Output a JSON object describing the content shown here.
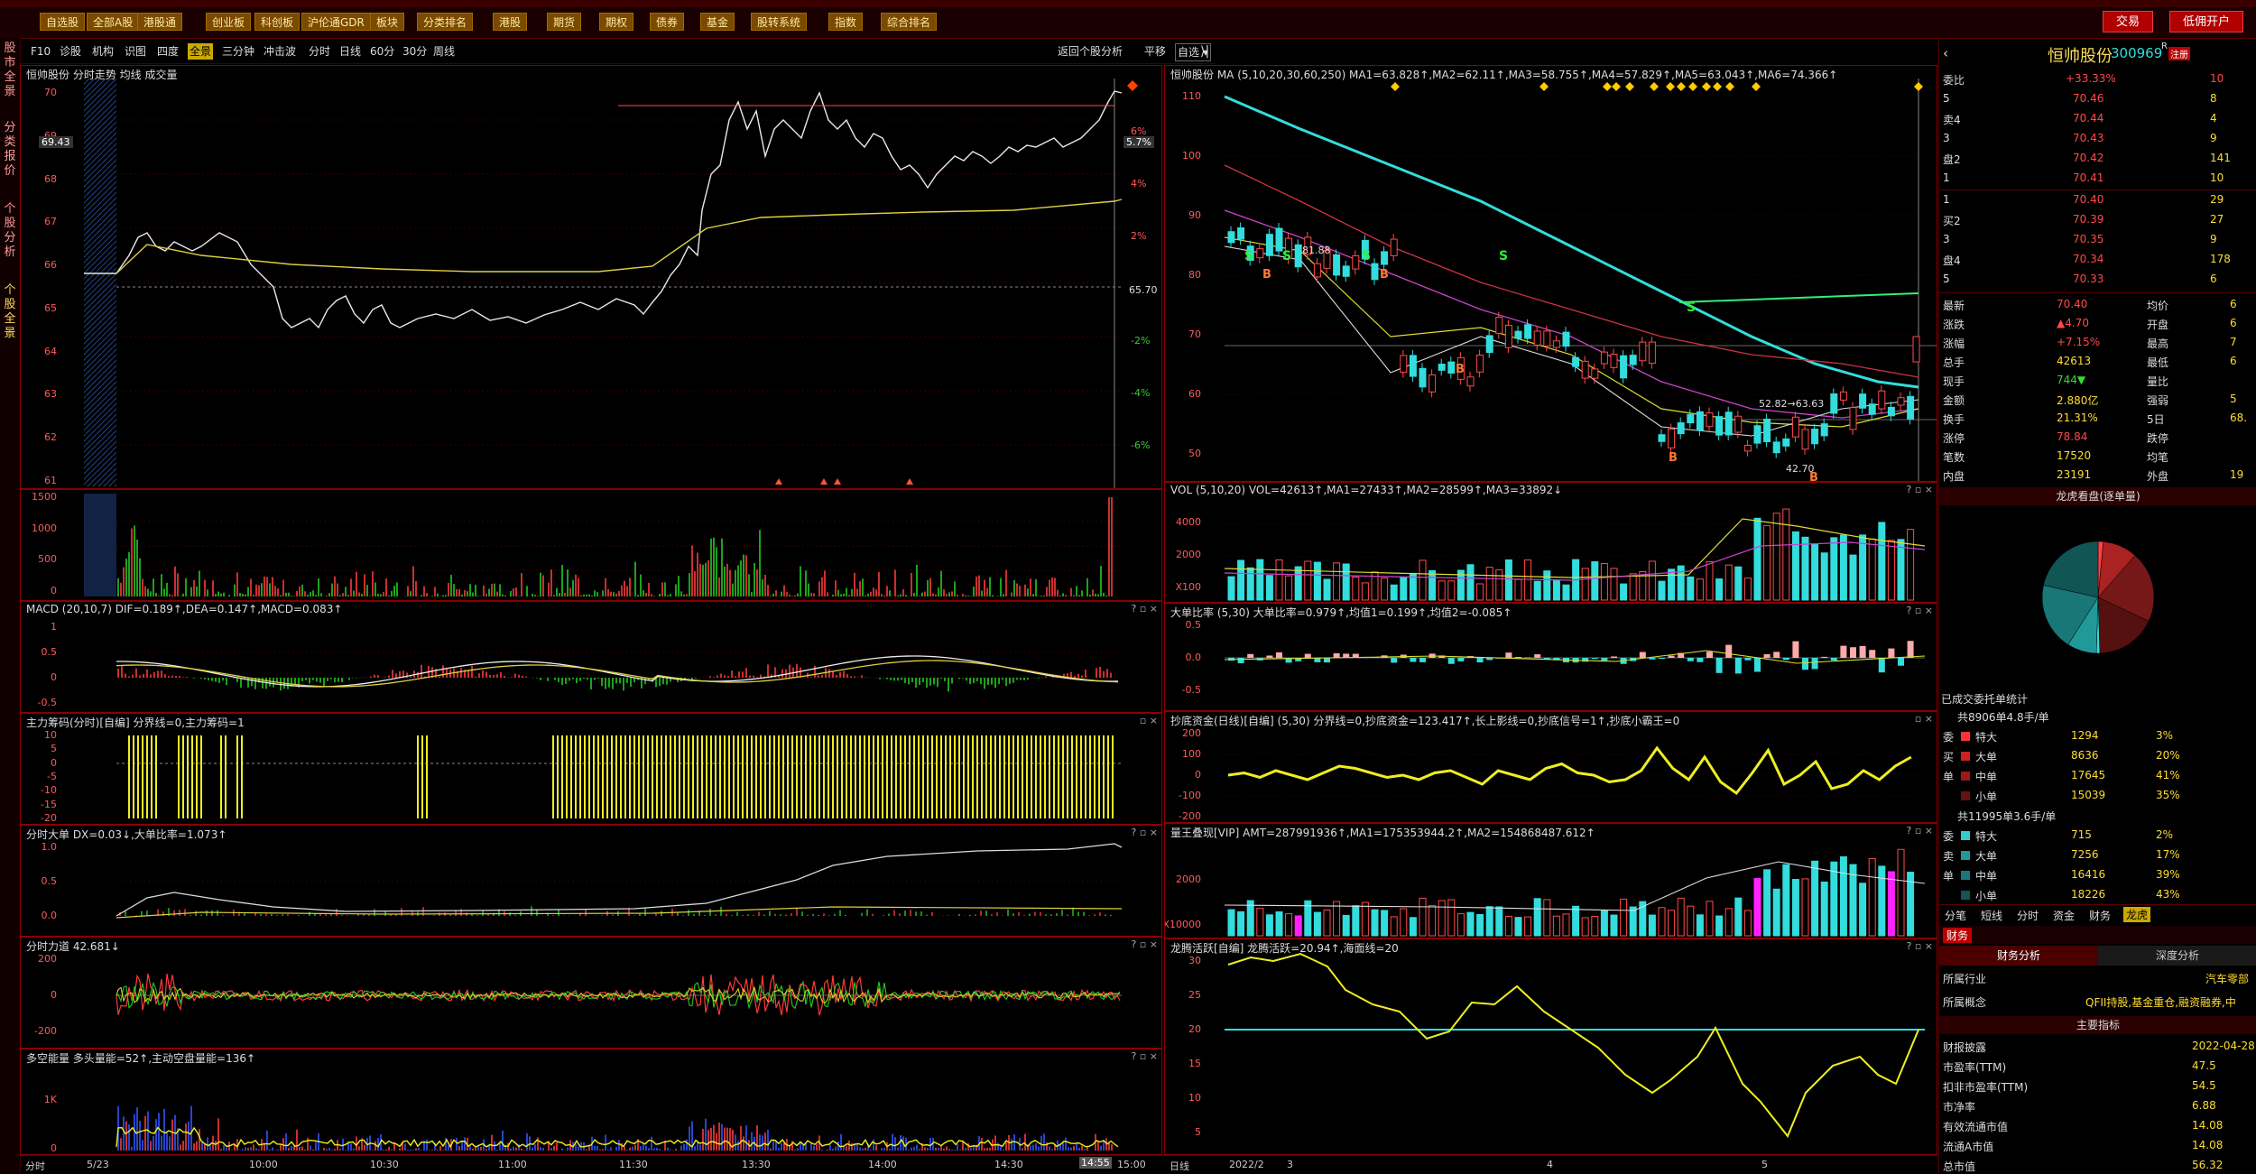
{
  "menubar": {
    "items": [
      "自选股",
      "全部A股",
      "港股通",
      "创业板",
      "科创板",
      "沪伦通GDR",
      "板块",
      "分类排名",
      "港股",
      "期货",
      "期权",
      "债券",
      "基金",
      "股转系统",
      "指数",
      "综合排名"
    ],
    "trade": "交易",
    "open_account": "低佣开户"
  },
  "leftstrip": {
    "tabs": [
      "股市全景",
      "分类报价",
      "个股分析",
      "个股全景"
    ]
  },
  "toolbar2": {
    "items": [
      "F10",
      "诊股",
      "机构",
      "识图",
      "四度",
      "全景",
      "三分钟",
      "冲击波",
      "分时",
      "日线",
      "60分",
      "30分",
      "周线"
    ],
    "selected": "全景",
    "return_label": "返回个股分析",
    "flat_label": "平移",
    "select_label": "自选"
  },
  "intraday": {
    "header": "恒帅股份  分时走势  均线  成交量",
    "price_label": "69.43",
    "pct_label": "5.7%",
    "mid_label": "65.70",
    "left_axis": [
      "70",
      "69",
      "68",
      "67",
      "66",
      "65",
      "64",
      "63",
      "62",
      "61"
    ],
    "right_axis": [
      "6%",
      "4%",
      "2%",
      "",
      "-2%",
      "-4%",
      "-6%"
    ],
    "vol_axis": [
      "1500",
      "1000",
      "500",
      "0"
    ],
    "macd_header": "MACD  (20,10,7)  DIF=0.189↑,DEA=0.147↑,MACD=0.083↑",
    "macd_axis": [
      "1",
      "0.5",
      "0",
      "-0.5"
    ],
    "chip_header": "主力筹码(分时)[自编]  分界线=0,主力筹码=1",
    "chip_axis": [
      "10",
      "5",
      "0",
      "-5",
      "-10",
      "-15",
      "-20"
    ],
    "bigorder_header": "分时大单  DX=0.03↓,大单比率=1.073↑",
    "bigorder_axis": [
      "1.0",
      "0.5",
      "0.0"
    ],
    "force_header": "分时力道  42.681↓",
    "force_axis": [
      "200",
      "0",
      "-200"
    ],
    "energy_header": "多空能量  多头量能=52↑,主动空盘量能=136↑",
    "energy_axis": [
      "1K",
      "0"
    ],
    "time_label": "分时",
    "times": [
      "5/23",
      "10:00",
      "10:30",
      "11:00",
      "11:30",
      "13:30",
      "14:00",
      "14:30",
      "14:55",
      "15:00"
    ]
  },
  "daily": {
    "header": "恒帅股份  MA  (5,10,20,30,60,250)  MA1=63.828↑,MA2=62.11↑,MA3=58.755↑,MA4=57.829↑,MA5=63.043↑,MA6=74.366↑",
    "left_axis": [
      "110",
      "100",
      "90",
      "80",
      "70",
      "60",
      "50"
    ],
    "annot_high": "81.88",
    "annot_low": "42.70",
    "annot_mid": "52.82→63.63",
    "vol_header": "VOL  (5,10,20)  VOL=42613↑,MA1=27433↑,MA2=28599↑,MA3=33892↓",
    "vol_axis": [
      "4000",
      "2000",
      "X100"
    ],
    "bigratio_header": "大单比率  (5,30)  大单比率=0.979↑,均值1=0.199↑,均值2=-0.085↑",
    "bigratio_axis": [
      "0.5",
      "0.0",
      "-0.5"
    ],
    "bottom_header": "抄底资金(日线)[自编]  (5,30)  分界线=0,抄底资金=123.417↑,长上影线=0,抄底信号=1↑,抄底小霸王=0",
    "bottom_axis": [
      "200",
      "100",
      "0",
      "-100",
      "-200"
    ],
    "kingvol_header": "量王叠现[VIP]  AMT=287991936↑,MA1=175353944.2↑,MA2=154868487.612↑",
    "kingvol_axis": [
      "2000",
      "X10000"
    ],
    "dragon_header": "龙腾活跃[自编]  龙腾活跃=20.94↑,海面线=20",
    "dragon_axis": [
      "30",
      "25",
      "20",
      "15",
      "10",
      "5"
    ],
    "day_label": "日线",
    "dates": [
      "2022/2",
      "3",
      "4",
      "5"
    ]
  },
  "quote": {
    "name": "恒帅股份",
    "code": "300969",
    "tag": "R",
    "tag2": "注册",
    "webi_label": "委比",
    "webi": "+33.33%",
    "webi_diff": "10",
    "sell": [
      {
        "lbl": "5",
        "price": "70.46",
        "vol": "8"
      },
      {
        "lbl": "卖4",
        "price": "70.44",
        "vol": "4"
      },
      {
        "lbl": "3",
        "price": "70.43",
        "vol": "9"
      },
      {
        "lbl": "盘2",
        "price": "70.42",
        "vol": "141"
      },
      {
        "lbl": "1",
        "price": "70.41",
        "vol": "10"
      }
    ],
    "buy": [
      {
        "lbl": "1",
        "price": "70.40",
        "vol": "29"
      },
      {
        "lbl": "买2",
        "price": "70.39",
        "vol": "27"
      },
      {
        "lbl": "3",
        "price": "70.35",
        "vol": "9"
      },
      {
        "lbl": "盘4",
        "price": "70.34",
        "vol": "178"
      },
      {
        "lbl": "5",
        "price": "70.33",
        "vol": "6"
      }
    ],
    "stats": [
      {
        "k": "最新",
        "v": "70.40",
        "k2": "均价",
        "v2": "6"
      },
      {
        "k": "涨跌",
        "v": "▲4.70",
        "k2": "开盘",
        "v2": "6"
      },
      {
        "k": "涨幅",
        "v": "+7.15%",
        "k2": "最高",
        "v2": "7"
      },
      {
        "k": "总手",
        "v": "42613",
        "k2": "最低",
        "v2": "6"
      },
      {
        "k": "现手",
        "v": "744▼",
        "k2": "量比",
        "v2": ""
      },
      {
        "k": "金额",
        "v": "2.880亿",
        "k2": "强弱",
        "v2": "5"
      },
      {
        "k": "换手",
        "v": "21.31%",
        "k2": "5日",
        "v2": "68."
      },
      {
        "k": "涨停",
        "v": "78.84",
        "k2": "跌停",
        "v2": ""
      },
      {
        "k": "笔数",
        "v": "17520",
        "k2": "均笔",
        "v2": ""
      },
      {
        "k": "内盘",
        "v": "23191",
        "k2": "外盘",
        "v2": "19"
      }
    ],
    "pie_title": "龙虎看盘(逐单量)",
    "entrust_label": "已成交委托单统计",
    "sell_summary": "共8906单4.8手/单",
    "sell_rows": [
      {
        "g": "委",
        "k": "特大",
        "n": "1294",
        "p": "3%"
      },
      {
        "g": "买",
        "k": "大单",
        "n": "8636",
        "p": "20%"
      },
      {
        "g": "单",
        "k": "中单",
        "n": "17645",
        "p": "41%"
      },
      {
        "g": "",
        "k": "小单",
        "n": "15039",
        "p": "35%"
      }
    ],
    "buy_summary": "共11995单3.6手/单",
    "buy_rows": [
      {
        "g": "委",
        "k": "特大",
        "n": "715",
        "p": "2%"
      },
      {
        "g": "卖",
        "k": "大单",
        "n": "7256",
        "p": "17%"
      },
      {
        "g": "单",
        "k": "中单",
        "n": "16416",
        "p": "39%"
      },
      {
        "g": "",
        "k": "小单",
        "n": "18226",
        "p": "43%"
      }
    ],
    "tabs": [
      "分笔",
      "短线",
      "分时",
      "资金",
      "财务",
      "龙虎"
    ],
    "fin_tab": "财务",
    "fin_sub": [
      "财务分析",
      "深度分析"
    ],
    "industry_k": "所属行业",
    "industry_v": "汽车零部",
    "concept_k": "所属概念",
    "concept_v": "QFII持股,基金重仓,融资融券,中",
    "main_index": "主要指标",
    "fin_rows": [
      {
        "k": "财报披露",
        "v": "2022-04-28"
      },
      {
        "k": "市盈率(TTM)",
        "v": "47.5"
      },
      {
        "k": "扣非市盈率(TTM)",
        "v": "54.5"
      },
      {
        "k": "市净率",
        "v": "6.88"
      },
      {
        "k": "有效流通市值",
        "v": "14.08"
      },
      {
        "k": "流通A市值",
        "v": "14.08"
      },
      {
        "k": "总市值",
        "v": "56.32"
      }
    ]
  }
}
